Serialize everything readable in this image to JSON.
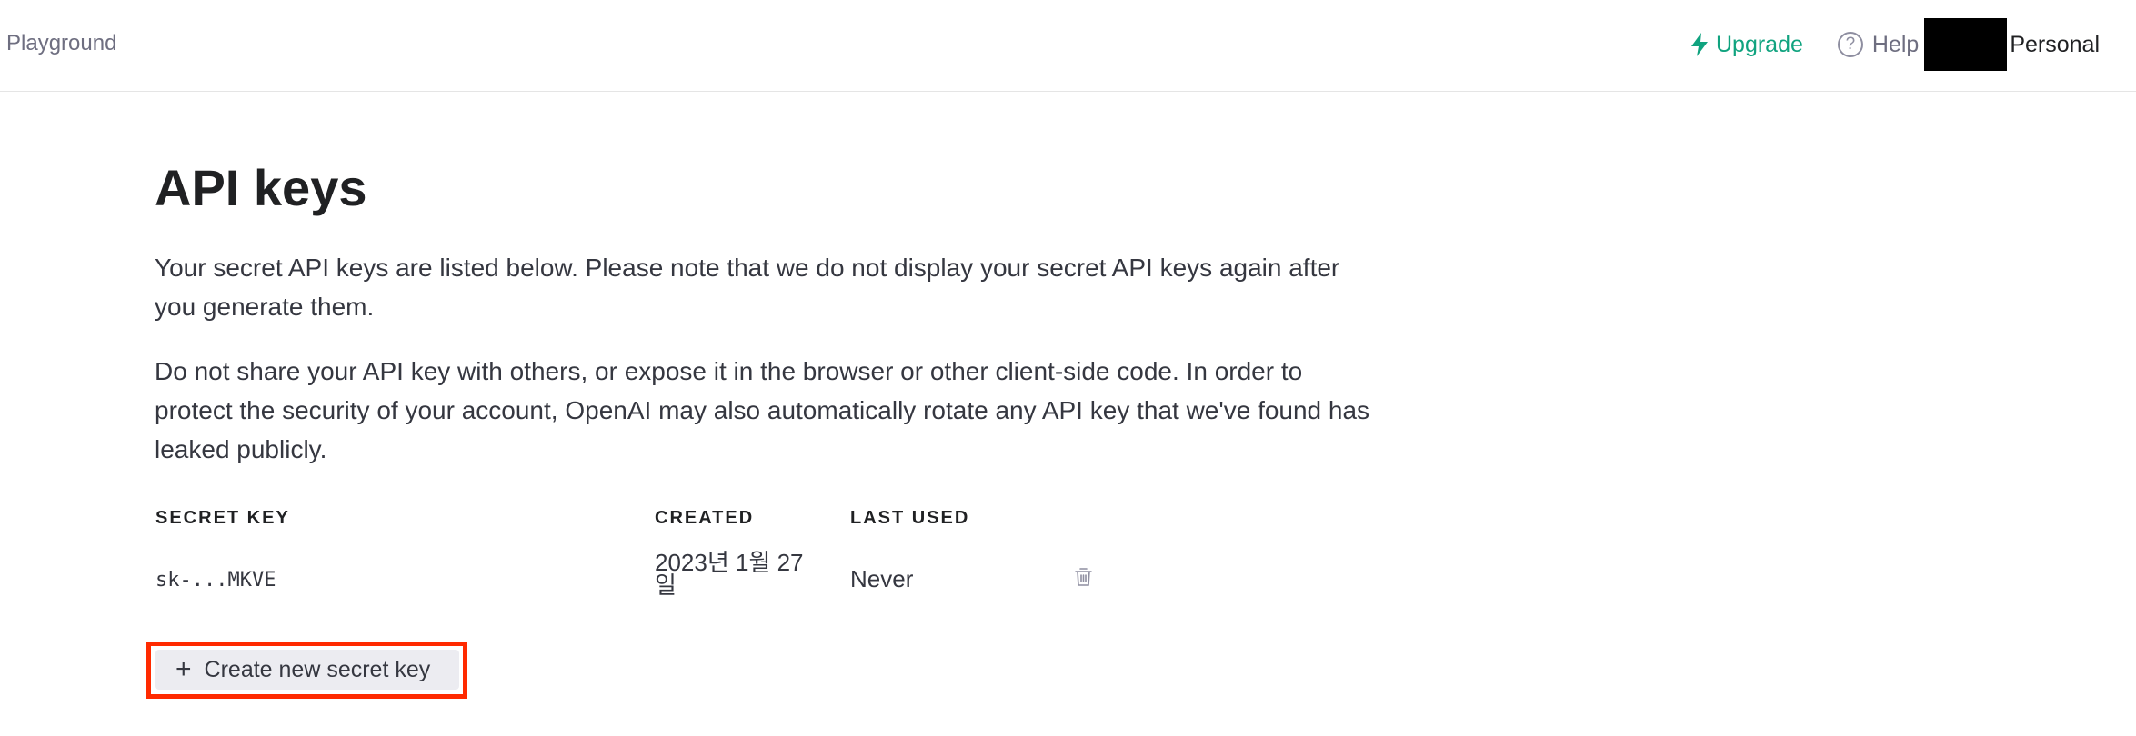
{
  "topbar": {
    "playground": "Playground",
    "upgrade": "Upgrade",
    "help": "Help",
    "help_icon": "?",
    "org": "Personal"
  },
  "page": {
    "title": "API keys",
    "para1": "Your secret API keys are listed below. Please note that we do not display your secret API keys again after you generate them.",
    "para2": "Do not share your API key with others, or expose it in the browser or other client-side code. In order to protect the security of your account, OpenAI may also automatically rotate any API key that we've found has leaked publicly."
  },
  "table": {
    "headers": {
      "secret_key": "SECRET KEY",
      "created": "CREATED",
      "last_used": "LAST USED"
    },
    "rows": [
      {
        "secret_key": "sk-...MKVE",
        "created": "2023년 1월 27일",
        "last_used": "Never"
      }
    ]
  },
  "actions": {
    "create_plus": "+",
    "create_label": "Create new secret key"
  },
  "colors": {
    "accent_green": "#10a37f",
    "highlight_red": "#ff2a00",
    "button_bg": "#ececf1"
  },
  "icons": {
    "upgrade": "bolt-icon",
    "help": "help-circle-icon",
    "delete": "trash-icon",
    "create": "plus-icon"
  }
}
